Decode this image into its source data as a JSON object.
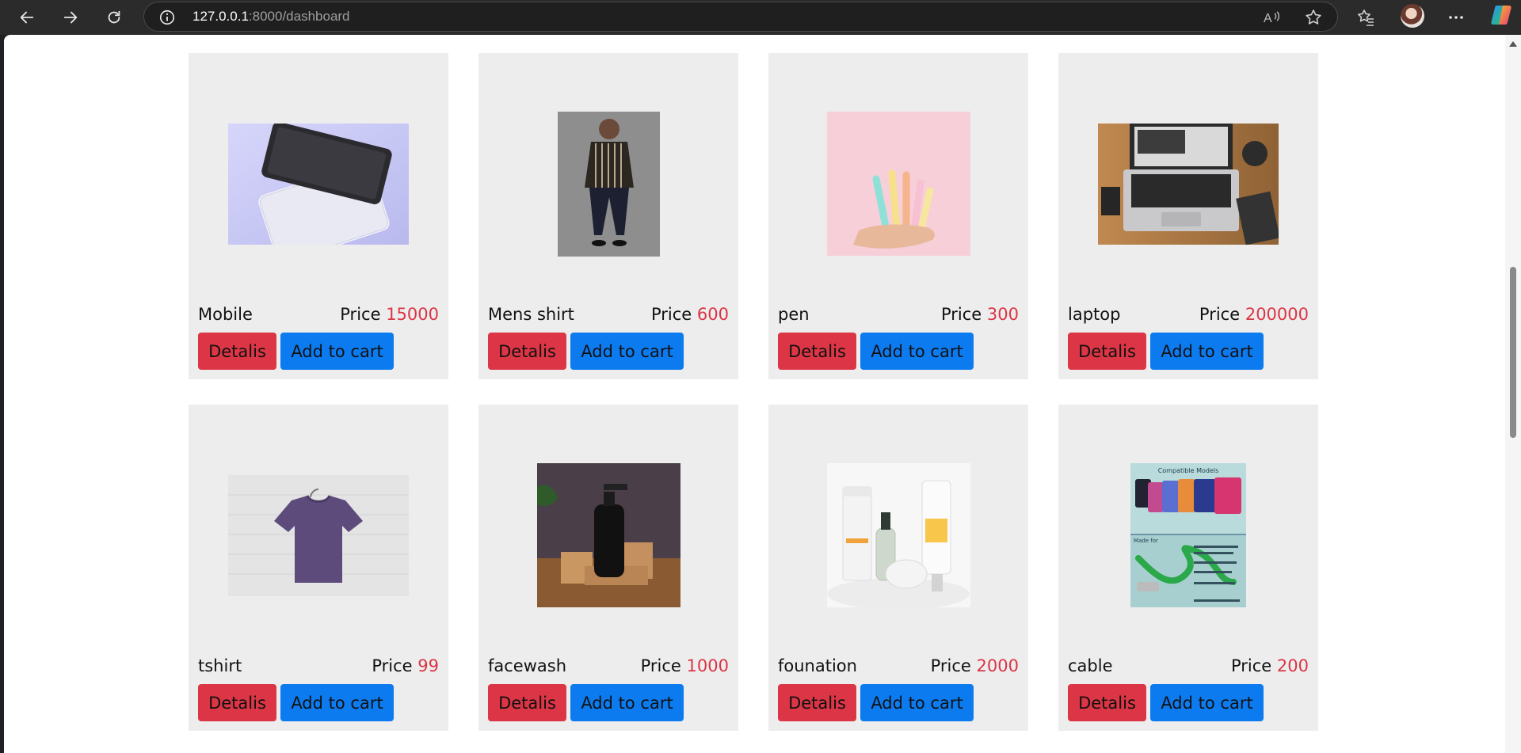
{
  "browser": {
    "url_host": "127.0.0.1",
    "url_rest": ":8000/dashboard"
  },
  "products": [
    {
      "name": "Mobile",
      "price_label": "Price",
      "price": "15000",
      "details_label": "Detalis",
      "cart_label": "Add to cart",
      "image": "tablet-image"
    },
    {
      "name": "Mens shirt",
      "price_label": "Price",
      "price": "600",
      "details_label": "Detalis",
      "cart_label": "Add to cart",
      "image": "shirt-model-image"
    },
    {
      "name": "pen",
      "price_label": "Price",
      "price": "300",
      "details_label": "Detalis",
      "cart_label": "Add to cart",
      "image": "pens-image"
    },
    {
      "name": "laptop",
      "price_label": "Price",
      "price": "200000",
      "details_label": "Detalis",
      "cart_label": "Add to cart",
      "image": "laptop-image"
    },
    {
      "name": "tshirt",
      "price_label": "Price",
      "price": "99",
      "details_label": "Detalis",
      "cart_label": "Add to cart",
      "image": "tshirt-image"
    },
    {
      "name": "facewash",
      "price_label": "Price",
      "price": "1000",
      "details_label": "Detalis",
      "cart_label": "Add to cart",
      "image": "facewash-bottle-image"
    },
    {
      "name": "founation",
      "price_label": "Price",
      "price": "2000",
      "details_label": "Detalis",
      "cart_label": "Add to cart",
      "image": "foundation-products-image"
    },
    {
      "name": "cable",
      "price_label": "Price",
      "price": "200",
      "details_label": "Detalis",
      "cart_label": "Add to cart",
      "image": "cable-image"
    }
  ],
  "cable_image_text": {
    "heading": "Compatible Models",
    "subheading": "Made for"
  },
  "colors": {
    "details_button": "#dc3545",
    "cart_button": "#0d7bf0",
    "price_value": "#dc3545",
    "card_bg": "#ededed"
  }
}
